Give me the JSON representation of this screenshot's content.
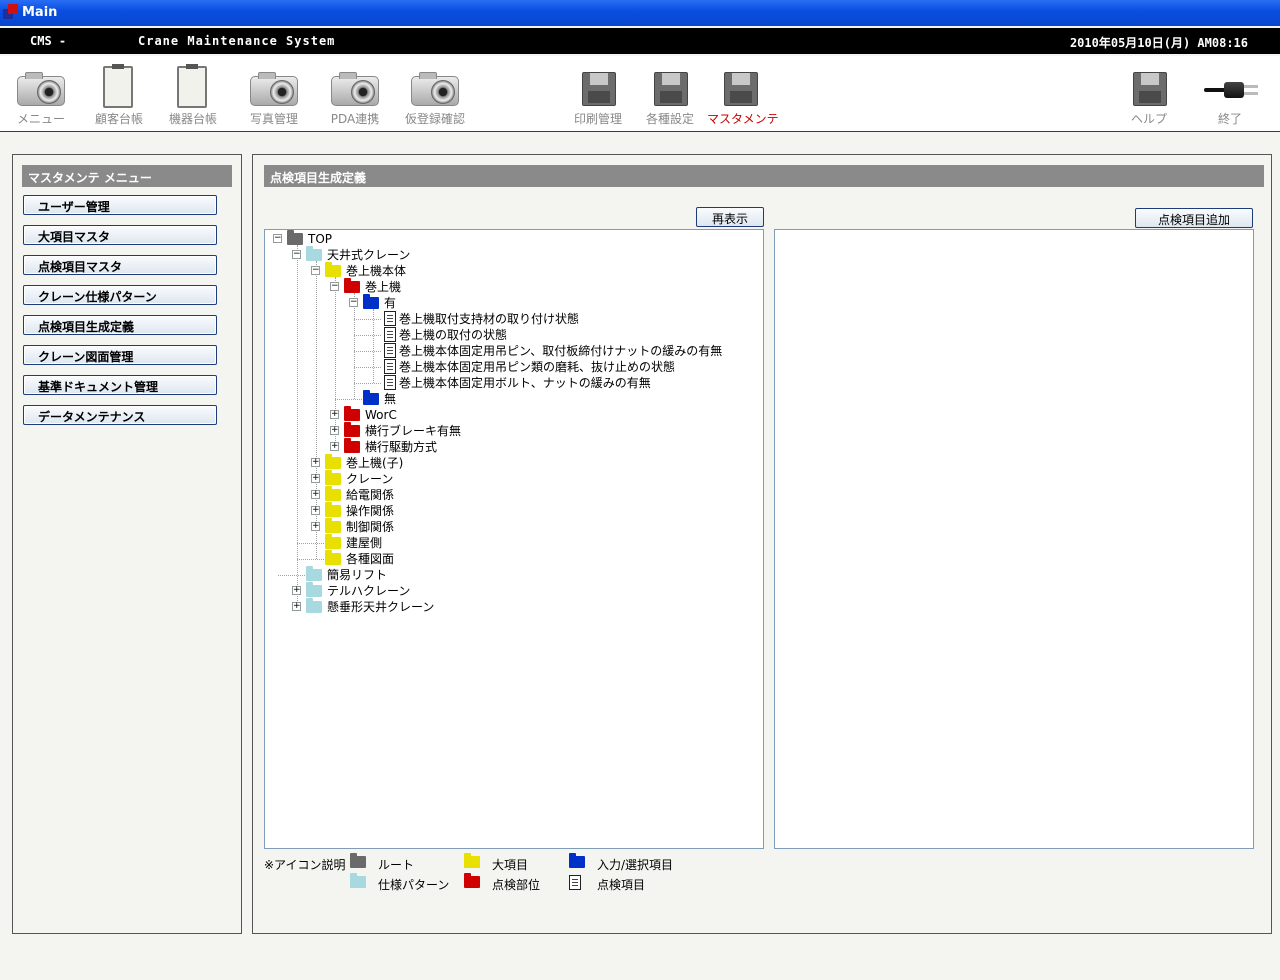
{
  "window": {
    "title": "Main"
  },
  "header": {
    "brand": "CMS -",
    "system": "Crane Maintenance System",
    "datetime": "2010年05月10日(月) AM08:16"
  },
  "toolbar": {
    "items": [
      {
        "label": "メニュー",
        "icon": "camera-icon"
      },
      {
        "label": "顧客台帳",
        "icon": "clipboard-icon"
      },
      {
        "label": "機器台帳",
        "icon": "clipboard-icon"
      },
      {
        "label": "写真管理",
        "icon": "camera-icon"
      },
      {
        "label": "PDA連携",
        "icon": "camera-icon"
      },
      {
        "label": "仮登録確認",
        "icon": "camera-icon"
      },
      {
        "label": "印刷管理",
        "icon": "disk-icon"
      },
      {
        "label": "各種設定",
        "icon": "disk-icon"
      },
      {
        "label": "マスタメンテ",
        "icon": "disk-icon",
        "active": true
      },
      {
        "label": "ヘルプ",
        "icon": "disk-icon"
      },
      {
        "label": "終了",
        "icon": "plug-icon"
      }
    ]
  },
  "sidebar": {
    "title": "マスタメンテ メニュー",
    "items": [
      {
        "label": "ユーザー管理"
      },
      {
        "label": "大項目マスタ"
      },
      {
        "label": "点検項目マスタ"
      },
      {
        "label": "クレーン仕様パターン"
      },
      {
        "label": "点検項目生成定義"
      },
      {
        "label": "クレーン図面管理"
      },
      {
        "label": "基準ドキュメント管理"
      },
      {
        "label": "データメンテナンス"
      }
    ]
  },
  "main": {
    "title": "点検項目生成定義",
    "refresh_label": "再表示",
    "add_label": "点検項目追加"
  },
  "colors": {
    "root": "#6a6a6a",
    "pattern": "#a8d8e0",
    "category": "#e8e000",
    "part": "#d00000",
    "input": "#0030c8"
  },
  "tree": [
    {
      "depth": 0,
      "type": "root",
      "label": "TOP",
      "toggle": "−"
    },
    {
      "depth": 1,
      "type": "pattern",
      "label": "天井式クレーン",
      "toggle": "−"
    },
    {
      "depth": 2,
      "type": "category",
      "label": "巻上機本体",
      "toggle": "−"
    },
    {
      "depth": 3,
      "type": "part",
      "label": "巻上機",
      "toggle": "−"
    },
    {
      "depth": 4,
      "type": "input",
      "label": "有",
      "toggle": "−"
    },
    {
      "depth": 5,
      "type": "item",
      "label": "巻上機取付支持材の取り付け状態"
    },
    {
      "depth": 5,
      "type": "item",
      "label": "巻上機の取付の状態"
    },
    {
      "depth": 5,
      "type": "item",
      "label": "巻上機本体固定用吊ピン、取付板締付けナットの緩みの有無"
    },
    {
      "depth": 5,
      "type": "item",
      "label": "巻上機本体固定用吊ピン類の磨耗、抜け止めの状態"
    },
    {
      "depth": 5,
      "type": "item",
      "label": "巻上機本体固定用ボルト、ナットの緩みの有無"
    },
    {
      "depth": 4,
      "type": "input",
      "label": "無"
    },
    {
      "depth": 3,
      "type": "part",
      "label": "WorC",
      "toggle": "+"
    },
    {
      "depth": 3,
      "type": "part",
      "label": "横行ブレーキ有無",
      "toggle": "+"
    },
    {
      "depth": 3,
      "type": "part",
      "label": "横行駆動方式",
      "toggle": "+"
    },
    {
      "depth": 2,
      "type": "category",
      "label": "巻上機(子)",
      "toggle": "+"
    },
    {
      "depth": 2,
      "type": "category",
      "label": "クレーン",
      "toggle": "+"
    },
    {
      "depth": 2,
      "type": "category",
      "label": "給電関係",
      "toggle": "+"
    },
    {
      "depth": 2,
      "type": "category",
      "label": "操作関係",
      "toggle": "+"
    },
    {
      "depth": 2,
      "type": "category",
      "label": "制御関係",
      "toggle": "+"
    },
    {
      "depth": 2,
      "type": "category",
      "label": "建屋側"
    },
    {
      "depth": 2,
      "type": "category",
      "label": "各種図面"
    },
    {
      "depth": 1,
      "type": "pattern",
      "label": "簡易リフト"
    },
    {
      "depth": 1,
      "type": "pattern",
      "label": "テルハクレーン",
      "toggle": "+"
    },
    {
      "depth": 1,
      "type": "pattern",
      "label": "懸垂形天井クレーン",
      "toggle": "+"
    }
  ],
  "legend": {
    "caption": "※アイコン説明",
    "items": [
      {
        "type": "root",
        "label": "ルート"
      },
      {
        "type": "category",
        "label": "大項目"
      },
      {
        "type": "input",
        "label": "入力/選択項目"
      },
      {
        "type": "pattern",
        "label": "仕様パターン"
      },
      {
        "type": "part",
        "label": "点検部位"
      },
      {
        "type": "item",
        "label": "点検項目"
      }
    ]
  }
}
